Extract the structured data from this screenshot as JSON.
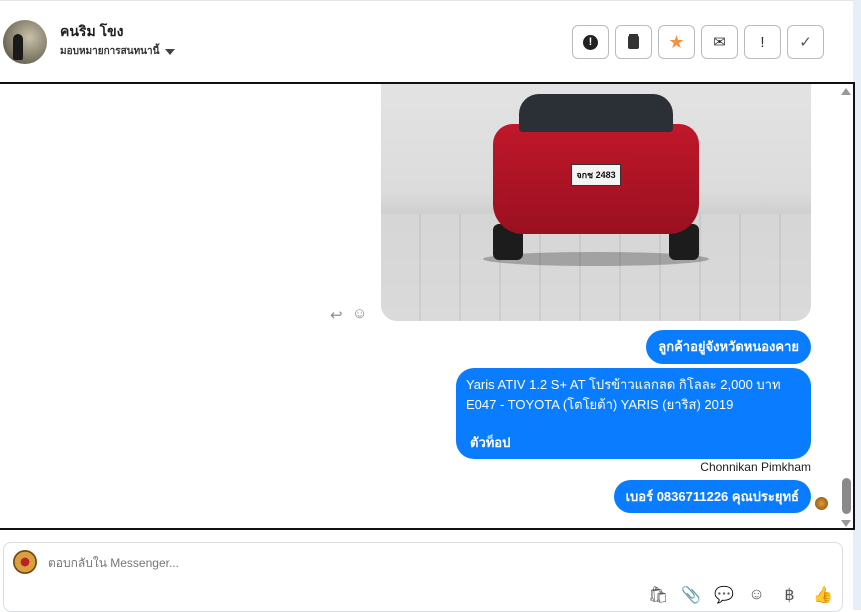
{
  "header": {
    "contact_name": "คนริม โขง",
    "assign_label": "มอบหมายการสนทนานี้",
    "actions": [
      {
        "name": "spam-button",
        "icon": "alert-circle-icon",
        "glyph": "●"
      },
      {
        "name": "delete-button",
        "icon": "trash-icon",
        "glyph": "🗑"
      },
      {
        "name": "star-button",
        "icon": "star-icon",
        "glyph": "★"
      },
      {
        "name": "mark-unread-button",
        "icon": "envelope-icon",
        "glyph": "✉"
      },
      {
        "name": "important-button",
        "icon": "exclamation-icon",
        "glyph": "!"
      },
      {
        "name": "done-button",
        "icon": "check-icon",
        "glyph": "✓"
      }
    ]
  },
  "colors": {
    "bubble": "#0a7cff",
    "star": "#f5923e",
    "side_strip": "#e6eef8"
  },
  "conversation": {
    "photo_plate": "จกช 2483",
    "messages": [
      {
        "text": "ลูกค้าอยู่จังหวัดหนองคาย"
      },
      {
        "lines": [
          "Yaris ATIV 1.2 S+ AT โปรข้าวแลกลด กิโลละ 2,000 บาท",
          "E047 - TOYOTA (โตโยต้า) YARIS (ยาริส) 2019"
        ],
        "footer": "ตัวท็อป"
      },
      {
        "text": "เบอร์ 0836711226 คุณประยุทธ์"
      }
    ],
    "sender": "Chonnikan Pimkham"
  },
  "composer": {
    "placeholder": "ตอบกลับใน Messenger...",
    "tools": [
      {
        "name": "shop-icon",
        "glyph": "🛍"
      },
      {
        "name": "attach-icon",
        "glyph": "📎"
      },
      {
        "name": "saved-reply-icon",
        "glyph": "💬"
      },
      {
        "name": "emoji-icon",
        "glyph": "☺"
      },
      {
        "name": "baht-icon",
        "glyph": "฿"
      },
      {
        "name": "like-icon",
        "glyph": "👍"
      }
    ]
  }
}
